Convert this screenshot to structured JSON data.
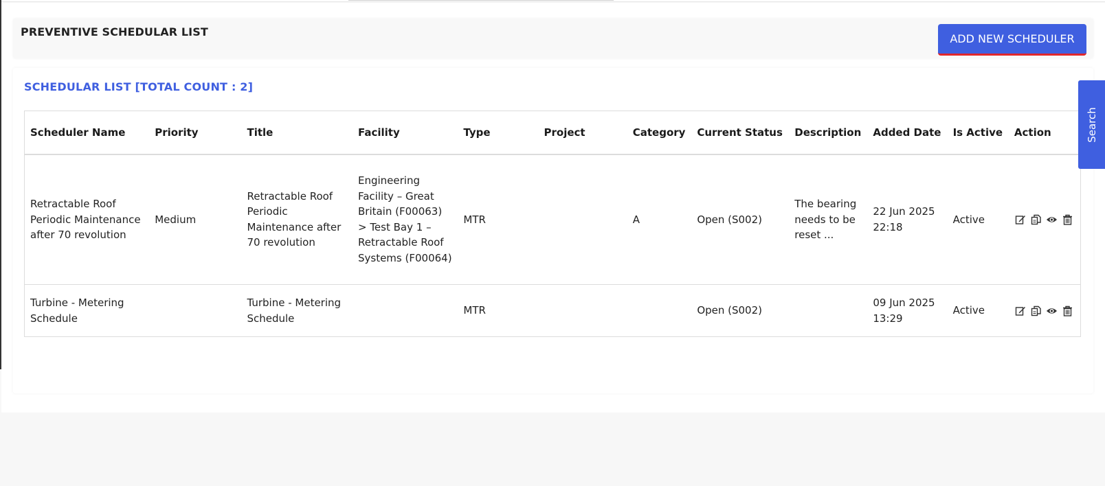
{
  "header": {
    "title": "PREVENTIVE SCHEDULAR LIST",
    "add_button": "ADD NEW SCHEDULER"
  },
  "list": {
    "title": "SCHEDULAR LIST [TOTAL COUNT : 2]",
    "columns": [
      "Scheduler Name",
      "Priority",
      "Title",
      "Facility",
      "Type",
      "Project",
      "Category",
      "Current Status",
      "Description",
      "Added Date",
      "Is Active",
      "Action"
    ],
    "rows": [
      {
        "scheduler_name": "Retractable Roof Periodic Maintenance after 70 revolution",
        "priority": "Medium",
        "title": "Retractable Roof Periodic Maintenance after 70 revolution",
        "facility": "Engineering Facility – Great Britain (F00063) > Test Bay 1 – Retractable Roof Systems (F00064)",
        "type": "MTR",
        "project": "",
        "category": "A",
        "current_status": "Open (S002)",
        "description": "The bearing needs to be reset ...",
        "added_date": "22 Jun 2025 22:18",
        "is_active": "Active",
        "actions": [
          "edit-icon",
          "copy-icon",
          "view-icon",
          "delete-icon"
        ]
      },
      {
        "scheduler_name": "Turbine - Metering Schedule",
        "priority": "",
        "title": "Turbine - Metering Schedule",
        "facility": "",
        "type": "MTR",
        "project": "",
        "category": "",
        "current_status": "Open (S002)",
        "description": "",
        "added_date": "09 Jun 2025 13:29",
        "is_active": "Active",
        "actions": [
          "edit-icon",
          "copy-icon",
          "view-icon",
          "delete-icon"
        ]
      }
    ]
  },
  "search_tab": {
    "label": "Search"
  },
  "colors": {
    "accent": "#3f5fe0",
    "button_underline": "#e0262b"
  }
}
